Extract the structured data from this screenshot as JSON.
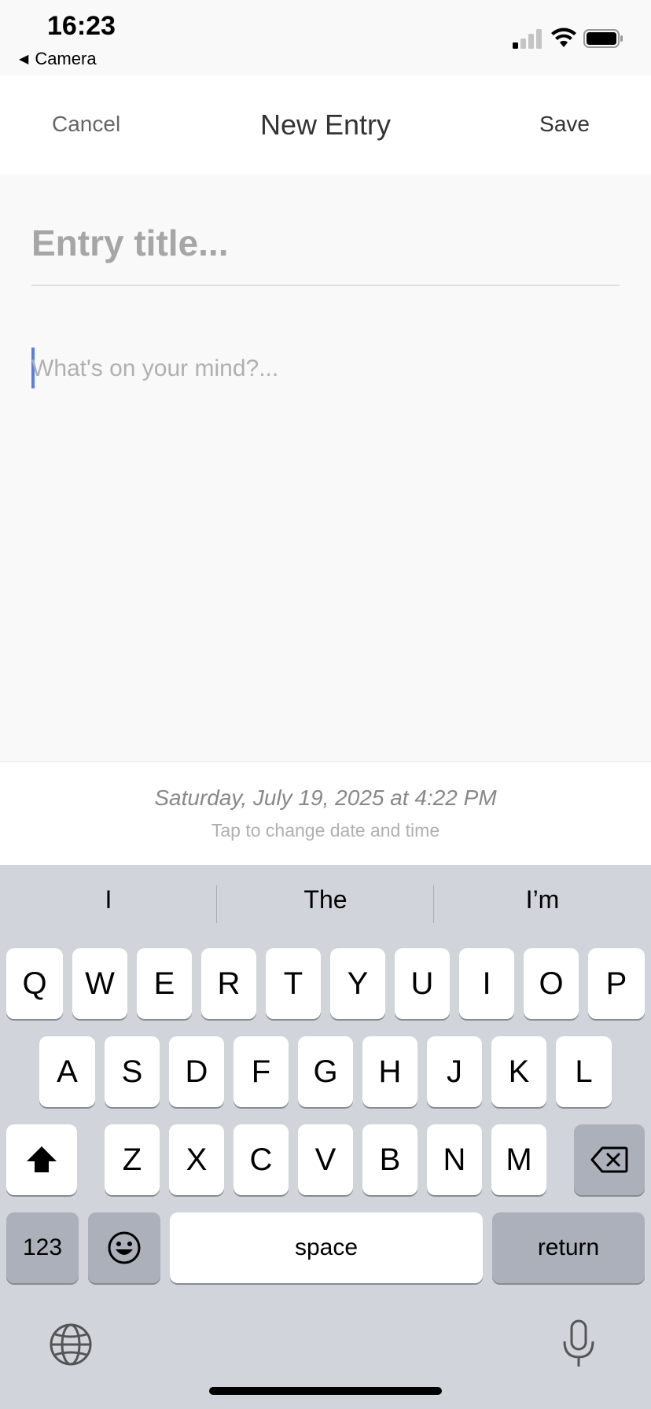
{
  "status_bar": {
    "time": "16:23",
    "back_app": "Camera",
    "back_arrow_icon": "back-triangle-icon"
  },
  "nav": {
    "cancel": "Cancel",
    "title": "New Entry",
    "save": "Save"
  },
  "editor": {
    "title_placeholder": "Entry title...",
    "body_placeholder": "What's on your mind?...",
    "cursor_color": "#5a7fe0"
  },
  "date": {
    "value": "Saturday, July 19, 2025 at 4:22 PM",
    "hint": "Tap to change date and time"
  },
  "keyboard": {
    "suggestions": [
      "I",
      "The",
      "I’m"
    ],
    "row1": [
      "Q",
      "W",
      "E",
      "R",
      "T",
      "Y",
      "U",
      "I",
      "O",
      "P"
    ],
    "row2": [
      "A",
      "S",
      "D",
      "F",
      "G",
      "H",
      "J",
      "K",
      "L"
    ],
    "row3": [
      "Z",
      "X",
      "C",
      "V",
      "B",
      "N",
      "M"
    ],
    "numbers_label": "123",
    "space_label": "space",
    "return_label": "return",
    "shift_icon": "shift-icon",
    "delete_icon": "delete-icon",
    "emoji_icon": "emoji-icon",
    "globe_icon": "globe-icon",
    "mic_icon": "microphone-icon"
  }
}
